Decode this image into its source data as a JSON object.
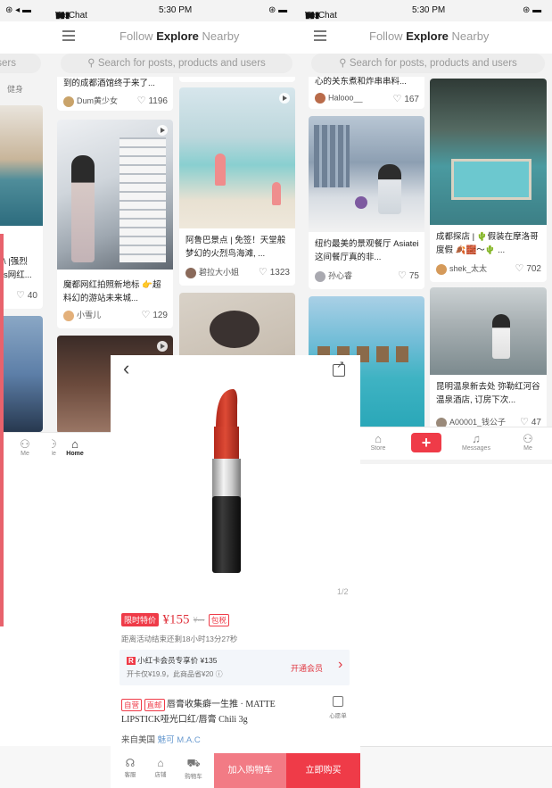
{
  "status_bar": {
    "left_icons": "⊛ ◂ ▬",
    "carrier": "WeChat",
    "signal": "▮▮▮",
    "wifi": "◠",
    "time": "5:30 PM",
    "right_icons": "⊛ ▬"
  },
  "nav": {
    "follow": "Follow",
    "explore": "Explore",
    "nearby": "Nearby"
  },
  "search": {
    "placeholder": "Search for posts, products and users",
    "partial": "sers"
  },
  "left_screen": {
    "chip": "健身",
    "card_caption_a": "\\ |强烈",
    "card_caption_b": "s网红...",
    "card_likes": "40",
    "nav_me": "Me"
  },
  "middle_screen": {
    "top_card": {
      "caption": "到的成都酒馆终于来了...",
      "author": "Dum黄少女",
      "likes": "1196"
    },
    "card_building": {
      "caption": "魔都网红拍照新地标 👉超料幻的游站未来城...",
      "author": "小雪儿",
      "likes": "129"
    },
    "card_flamingo": {
      "caption": "阿鲁巴景点 | 免签！天堂般梦幻的火烈鸟海滩, ...",
      "author": "碧拉大小姐",
      "likes": "1323"
    },
    "nav_me": "Me",
    "nav_home": "Home"
  },
  "right_screen": {
    "top_card": {
      "caption": "心的关东煮和炸串串料...",
      "author": "Halooo__",
      "likes": "167"
    },
    "card_restaurant": {
      "caption": "纽约最美的景观餐厅 Asiatei 这间餐厅真的非...",
      "author": "孙心睿",
      "likes": "75"
    },
    "card_pool": {
      "caption": "成都探店 | 🌵假装在摩洛哥度假 🍂🧱～🌵 ...",
      "author": "shek_太太",
      "likes": "702"
    },
    "card_onsen": {
      "caption": "昆明温泉新去处 弥勒红河谷温泉酒店, 订房下次...",
      "author": "A00001_钱公子",
      "likes": "47"
    },
    "bottom_nav": {
      "store": "Store",
      "plus": "+",
      "messages": "Messages",
      "me": "Me"
    }
  },
  "product": {
    "back": "‹",
    "share": "↗",
    "counter": "1/2",
    "promo_tag": "限时特价",
    "price": "¥155",
    "orig_price": "¥---",
    "tax_tag": "包税",
    "countdown": "距离活动结束还剩18小时13分27秒",
    "member_badge": "R",
    "member_price": "小红卡会员专享价 ¥135",
    "member_note": "开卡仅¥19.9，此商品省¥20 ⓘ",
    "member_cta": "开通会员",
    "member_arrow": "›",
    "tag_self": "自营",
    "tag_direct": "直邮",
    "title_line1": "唇膏收集癖一生推 · MATTE",
    "title_line2": "LIPSTICK哑光口红/唇膏 Chili 3g",
    "wishlist": "心愿单",
    "origin_prefix": "来自美国",
    "brand": "魅可 M.A.C",
    "bottom": {
      "service": "客服",
      "store": "店铺",
      "cart": "购物车",
      "add_cart": "加入购物车",
      "buy_now": "立即购买"
    }
  },
  "colors": {
    "accent": "#ef3b48",
    "pink_bar": "#e8626c",
    "price_red": "#e0353f"
  }
}
